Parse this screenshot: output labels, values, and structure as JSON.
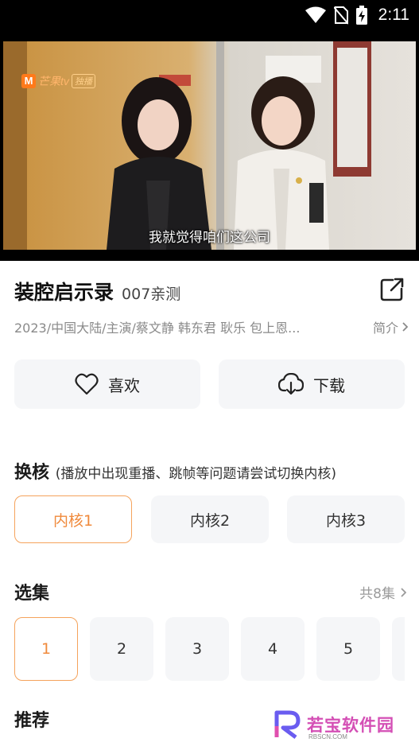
{
  "status_bar": {
    "time": "2:11",
    "icons": [
      "wifi-icon",
      "no-sim-icon",
      "battery-charging-icon"
    ]
  },
  "video": {
    "logo_text": "芒果tv",
    "logo_mark": "M",
    "logo_badge": "独播",
    "subtitle": "我就觉得咱们这公司"
  },
  "info": {
    "title": "装腔启示录",
    "source": "007亲测",
    "meta": "2023/中国大陆/主演/蔡文静  韩东君  耿乐  包上恩...",
    "intro_label": "简介"
  },
  "actions": {
    "like_label": "喜欢",
    "download_label": "下载"
  },
  "core": {
    "title": "换核",
    "note": "(播放中出现重播、跳帧等问题请尝试切换内核)",
    "options": [
      "内核1",
      "内核2",
      "内核3"
    ],
    "selected": "内核1"
  },
  "episodes": {
    "title": "选集",
    "total_label": "共8集",
    "items": [
      "1",
      "2",
      "3",
      "4",
      "5"
    ],
    "selected": "1"
  },
  "recommend": {
    "title": "推荐"
  },
  "watermark": {
    "text": "若宝软件园",
    "sub": "RBSCN.COM"
  },
  "colors": {
    "accent": "#f08a3c",
    "accent_border": "#f5a35c",
    "button_bg": "#f5f6f8",
    "muted": "#8a8a8a"
  }
}
